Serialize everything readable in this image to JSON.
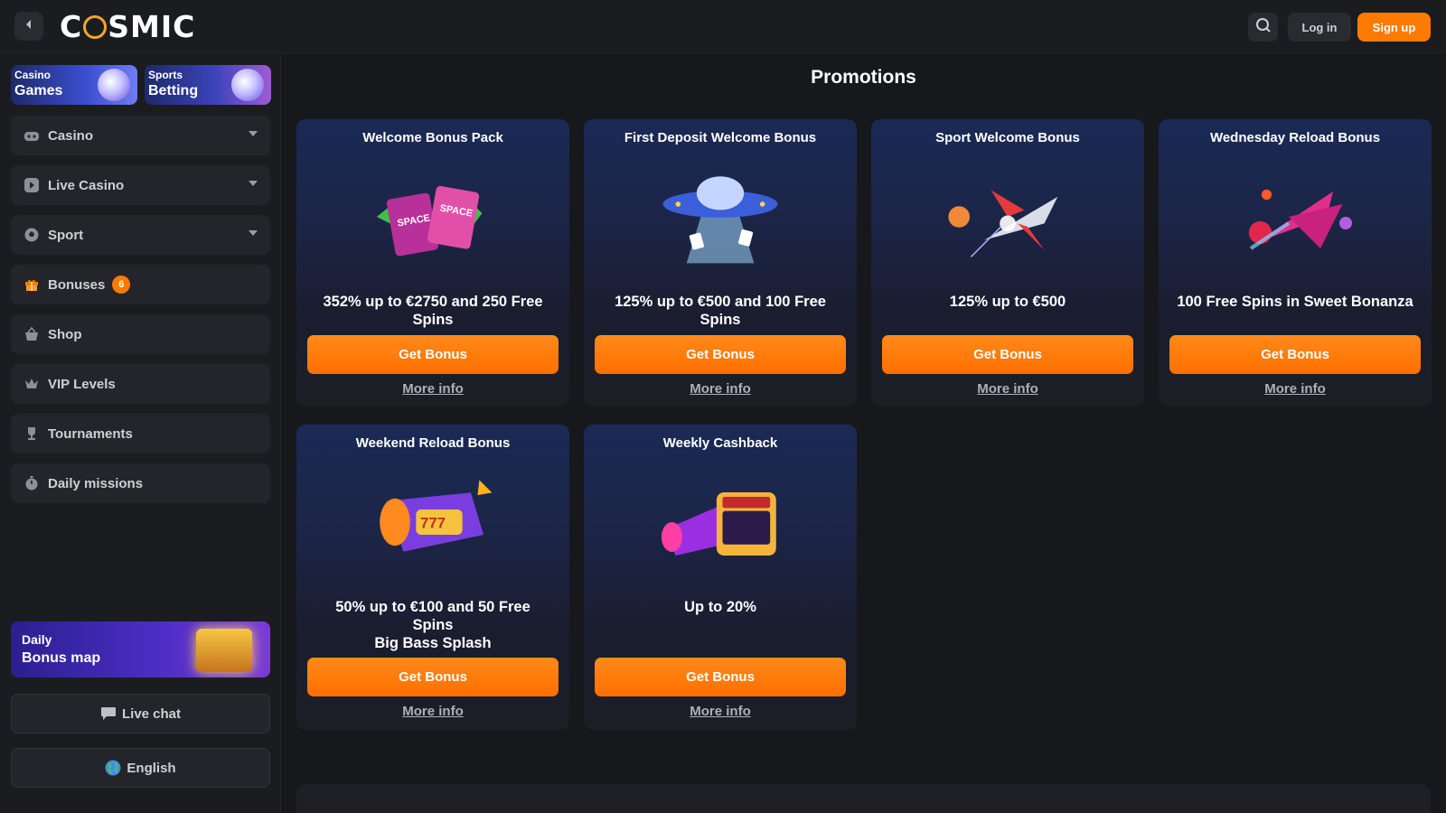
{
  "header": {
    "logo_text": "COSMIC",
    "login_label": "Log in",
    "signup_label": "Sign up"
  },
  "sidebar": {
    "tiles": [
      {
        "small": "Casino",
        "big": "Games"
      },
      {
        "small": "Sports",
        "big": "Betting"
      }
    ],
    "items": [
      {
        "label": "Casino",
        "icon": "gamepad-icon",
        "has_dropdown": true
      },
      {
        "label": "Live Casino",
        "icon": "play-icon",
        "has_dropdown": true
      },
      {
        "label": "Sport",
        "icon": "soccer-ball-icon",
        "has_dropdown": true
      },
      {
        "label": "Bonuses",
        "icon": "gift-icon",
        "badge": "6",
        "active": true
      },
      {
        "label": "Shop",
        "icon": "shop-basket-icon"
      },
      {
        "label": "VIP Levels",
        "icon": "crown-icon"
      },
      {
        "label": "Tournaments",
        "icon": "trophy-icon"
      },
      {
        "label": "Daily missions",
        "icon": "stopwatch-icon"
      }
    ],
    "bonus_map": {
      "line1": "Daily",
      "line2": "Bonus map"
    },
    "live_chat_label": "Live chat",
    "language_label": "English"
  },
  "main": {
    "title": "Promotions",
    "cards": [
      {
        "title": "Welcome Bonus Pack",
        "desc_lines": [
          "352% up to €2750 and 250 Free",
          "Spins"
        ],
        "button": "Get Bonus",
        "more": "More info",
        "art": "space-food-art"
      },
      {
        "title": "First Deposit Welcome Bonus",
        "desc_lines": [
          "125% up to €500 and 100 Free",
          "Spins"
        ],
        "button": "Get Bonus",
        "more": "More info",
        "art": "ufo-art"
      },
      {
        "title": "Sport Welcome Bonus",
        "desc_lines": [
          "125% up to €500"
        ],
        "button": "Get Bonus",
        "more": "More info",
        "art": "rocket-art"
      },
      {
        "title": "Wednesday Reload Bonus",
        "desc_lines": [
          "100 Free Spins in Sweet Bonanza"
        ],
        "button": "Get Bonus",
        "more": "More info",
        "art": "spaceship-art"
      },
      {
        "title": "Weekend Reload Bonus",
        "desc_lines": [
          "50% up to €100 and 50 Free",
          "Spins",
          "Big Bass Splash"
        ],
        "button": "Get Bonus",
        "more": "More info",
        "art": "slot-blaster-art"
      },
      {
        "title": "Weekly Cashback",
        "desc_lines": [
          "Up to 20%"
        ],
        "button": "Get Bonus",
        "more": "More info",
        "art": "jackpot-blaster-art"
      }
    ]
  },
  "colors": {
    "accent": "#ff7a00",
    "bg": "#17181c",
    "panel": "#24252a"
  }
}
